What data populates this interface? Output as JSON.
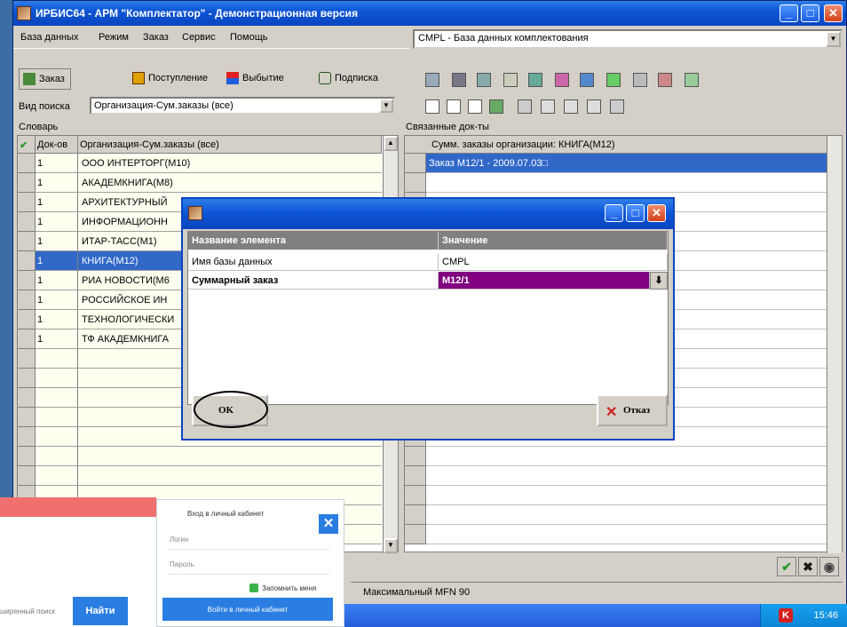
{
  "window": {
    "title": "ИРБИС64 - АРМ \"Комплектатор\" - Демонстрационная версия",
    "min": "_",
    "max": "□",
    "close": "✕"
  },
  "menu": [
    "База данных",
    "Режим",
    "Заказ",
    "Сервис",
    "Помощь"
  ],
  "db_select": {
    "value": "CMPL - База данных комплектования",
    "arrow": "▼"
  },
  "toolbar": {
    "order": "Заказ",
    "receipt": "Поступление",
    "removal": "Выбытие",
    "subscription": "Подписка"
  },
  "search": {
    "label": "Вид поиска",
    "value": "Организация-Сум.заказы (все)"
  },
  "dictionary": {
    "title": "Словарь",
    "check": "✔",
    "col_count": "Док-ов",
    "col_org": "Организация-Сум.заказы (все)",
    "rows": [
      {
        "count": "1",
        "org": "ООО ИНТЕРТОРГ(М10)"
      },
      {
        "count": "1",
        "org": "АКАДЕМКНИГА(М8)"
      },
      {
        "count": "1",
        "org": "АРХИТЕКТУРНЫЙ"
      },
      {
        "count": "1",
        "org": "ИНФОРМАЦИОНН"
      },
      {
        "count": "1",
        "org": "ИТАР-ТАСС(М1)"
      },
      {
        "count": "1",
        "org": "КНИГА(М12)"
      },
      {
        "count": "1",
        "org": "РИА НОВОСТИ(М6"
      },
      {
        "count": "1",
        "org": "РОССИЙСКОЕ ИН"
      },
      {
        "count": "1",
        "org": "ТЕХНОЛОГИЧЕСКИ"
      },
      {
        "count": "1",
        "org": "ТФ АКАДЕМКНИГА"
      }
    ],
    "selected_index": 5
  },
  "linked": {
    "title": "Связанные док-ты",
    "header": "Сумм. заказы организации: КНИГА(М12)",
    "rows": [
      "Заказ М12/1 - 2009.07.03□"
    ]
  },
  "status": {
    "text": "Максимальный MFN 90"
  },
  "dialog": {
    "col_name": "Название элемента",
    "col_value": "Значение",
    "rows": [
      {
        "name": "Имя базы данных",
        "value": "CMPL"
      },
      {
        "name": "Суммарный заказ",
        "value": "M12/1"
      }
    ],
    "ok": "OK",
    "cancel": "Отказ",
    "cancel_icon": "✕"
  },
  "taskbar": {
    "clock": "15:46"
  },
  "overlay": {
    "login_title": "Вход в личный кабинет",
    "login_placeholder": "Логин",
    "password_placeholder": "Пароль",
    "remember": "Запомнить меня",
    "login_button": "Войти в личный кабинет",
    "close": "✕",
    "advanced_search": "ширенный поиск",
    "find": "Найти"
  },
  "colors": {
    "title_blue": "#0d55d6",
    "selection": "#3168c8",
    "dialog_active": "#800080",
    "overlay_blue": "#2a7de1"
  }
}
